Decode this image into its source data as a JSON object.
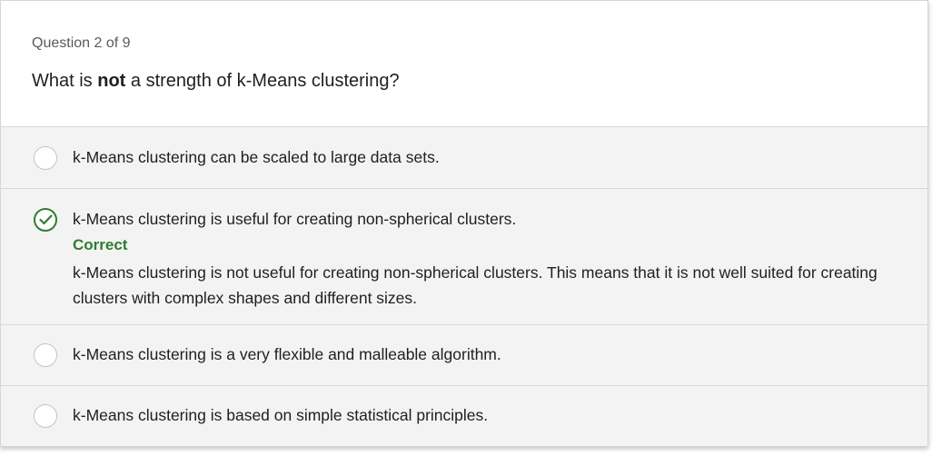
{
  "question": {
    "counter": "Question 2 of 9",
    "text_before": "What is ",
    "text_bold": "not",
    "text_after": " a strength of k-Means clustering?"
  },
  "options": [
    {
      "label": "k-Means clustering can be scaled to large data sets.",
      "selected": false
    },
    {
      "label": "k-Means clustering is useful for creating non-spherical clusters.",
      "selected": true,
      "feedback_title": "Correct",
      "feedback_text": "k-Means clustering is not useful for creating non-spherical clusters. This means that it is not well suited for creating clusters with complex shapes and different sizes."
    },
    {
      "label": "k-Means clustering is a very flexible and malleable algorithm.",
      "selected": false
    },
    {
      "label": "k-Means clustering is based on simple statistical principles.",
      "selected": false
    }
  ],
  "colors": {
    "correct": "#2e7d32",
    "option_bg": "#f3f3f3",
    "divider": "#d8d8d8"
  },
  "icons": {
    "correct": "check-circle-icon",
    "unselected": "radio-empty-icon"
  }
}
